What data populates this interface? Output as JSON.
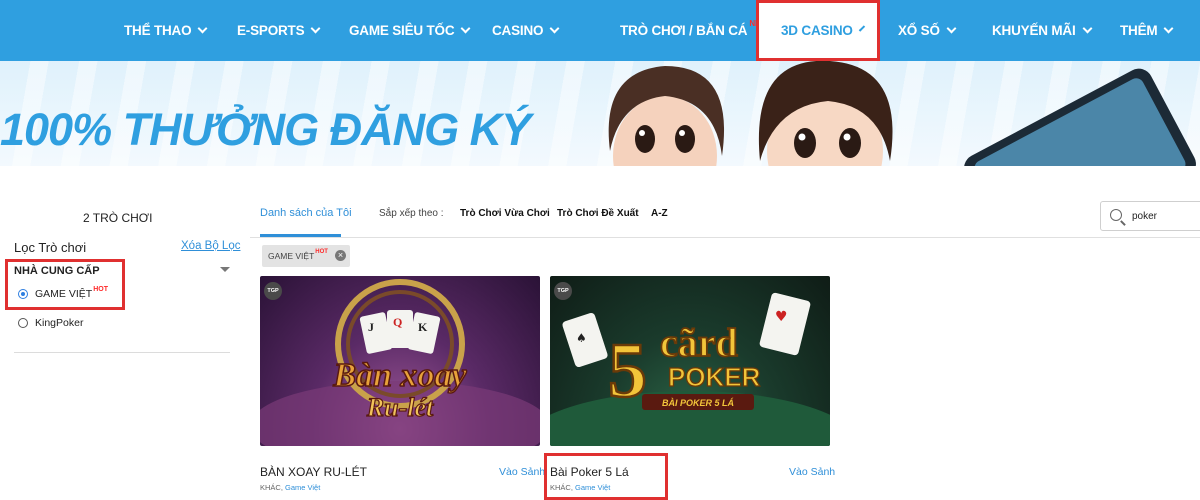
{
  "nav": {
    "items": [
      {
        "label": "THỂ THAO",
        "has_dropdown": true
      },
      {
        "label": "E-SPORTS",
        "has_dropdown": true
      },
      {
        "label": "GAME SIÊU TỐC",
        "has_dropdown": true
      },
      {
        "label": "CASINO",
        "has_dropdown": true
      },
      {
        "label": "TRÒ CHƠI / BẮN CÁ",
        "badge": "NEW!",
        "has_dropdown": true
      },
      {
        "label": "3D CASINO",
        "has_dropdown": true,
        "active": true
      },
      {
        "label": "XỔ SỐ",
        "has_dropdown": true
      },
      {
        "label": "KHUYẾN MÃI",
        "has_dropdown": true
      },
      {
        "label": "THÊM",
        "has_dropdown": true
      }
    ]
  },
  "banner": {
    "title": "100% THƯỞNG ĐĂNG KÝ"
  },
  "filter": {
    "count": "2  TRÒ CHƠI",
    "title": "Lọc Trò chơi",
    "clear": "Xóa Bộ Lọc",
    "provider_heading": "NHÀ CUNG CẤP",
    "providers": [
      {
        "label": "GAME VIỆT",
        "badge": "HOT",
        "selected": true
      },
      {
        "label": "KingPoker",
        "selected": false
      }
    ]
  },
  "sortbar": {
    "my_list": "Danh sách của Tôi",
    "sort_label": "Sắp xếp theo :",
    "options": [
      "Trò Chơi Vừa Chơi",
      "Trò Chơi Đề Xuất",
      "A-Z"
    ]
  },
  "search": {
    "value": "poker"
  },
  "chip": {
    "label": "GAME VIỆT",
    "badge": "HOT",
    "close_icon": "close-circle-icon"
  },
  "games": [
    {
      "name": "BÀN XOAY RU-LÉT",
      "lobby": "Vào Sảnh",
      "category": "KHÁC,",
      "provider": "Game Việt",
      "tag": "TGP",
      "art_text": [
        "Bàn xoay",
        "Ru-lét"
      ]
    },
    {
      "name": "Bài Poker 5 Lá",
      "lobby": "Vào Sảnh",
      "category": "KHÁC,",
      "provider": "Game Việt",
      "tag": "TGP",
      "art_text": [
        "5",
        "cãrd",
        "POKER",
        "BÀI POKER 5 LÁ"
      ]
    }
  ],
  "colors": {
    "nav_bg": "#2f9fe0",
    "accent": "#2f8fd8",
    "highlight": "#e03030",
    "hot": "#ff2a2a"
  }
}
